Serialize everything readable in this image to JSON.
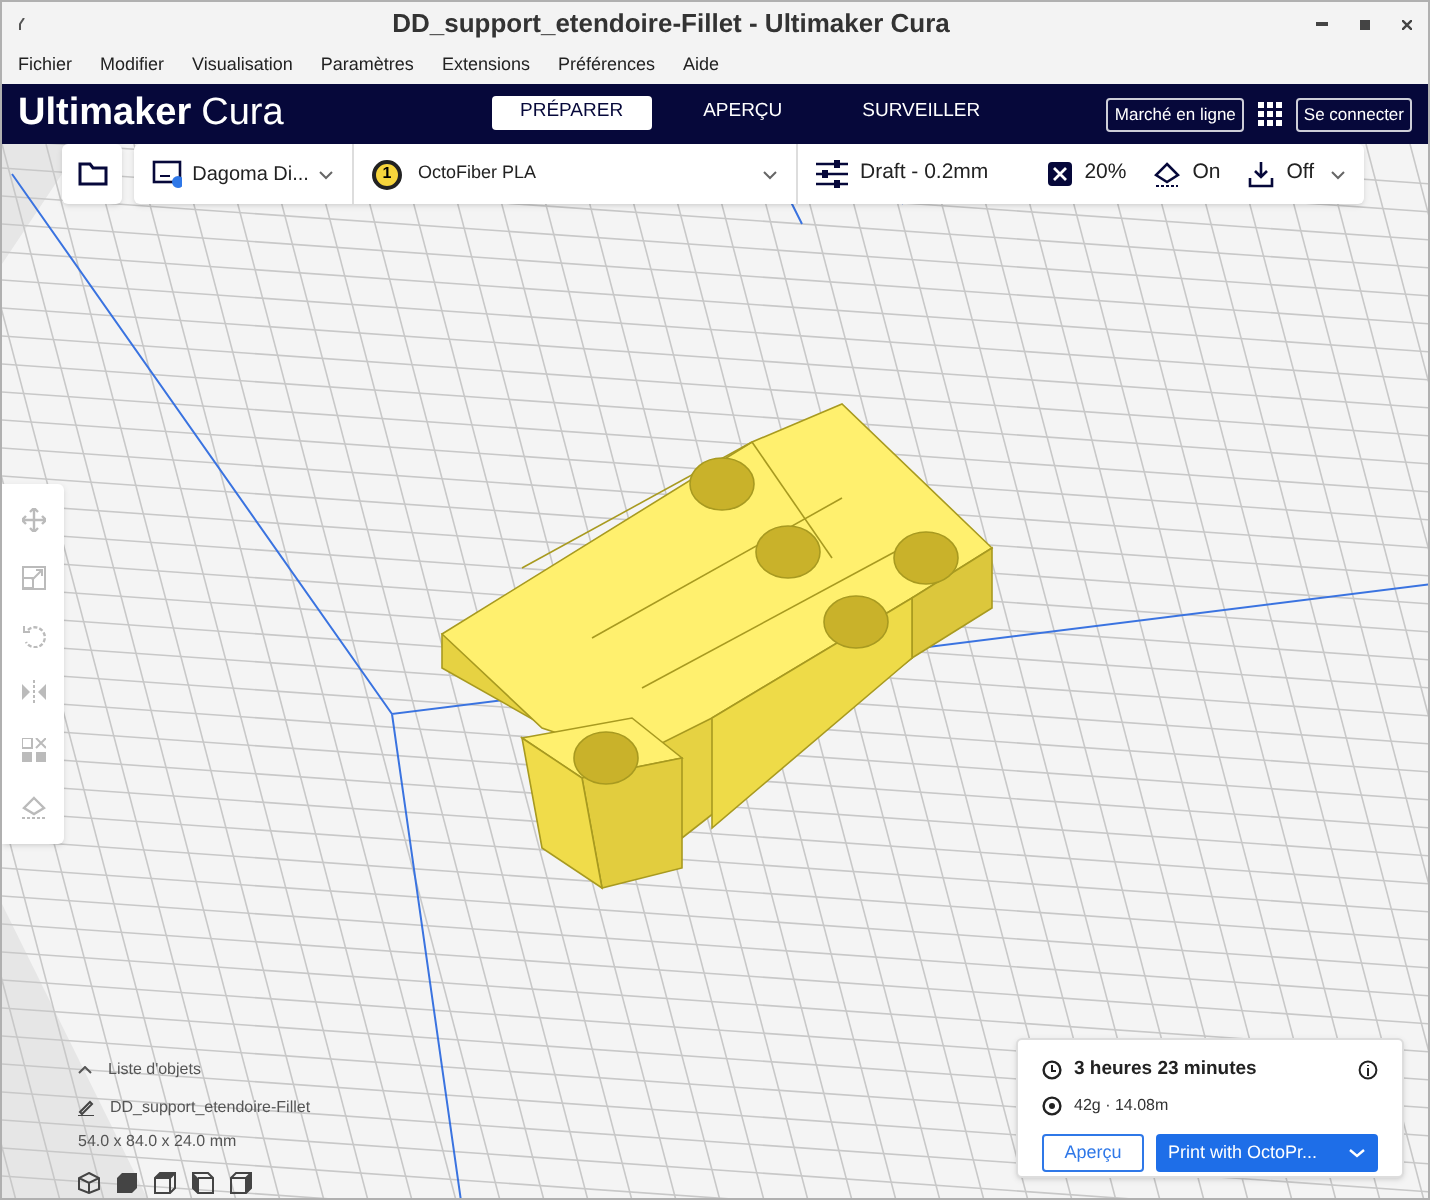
{
  "window": {
    "title": "DD_support_etendoire-Fillet - Ultimaker Cura"
  },
  "menu": [
    "Fichier",
    "Modifier",
    "Visualisation",
    "Paramètres",
    "Extensions",
    "Préférences",
    "Aide"
  ],
  "header": {
    "brand": "Ultimaker",
    "product": "Cura",
    "tabs": [
      {
        "label": "PRÉPARER",
        "selected": true
      },
      {
        "label": "APERÇU",
        "selected": false
      },
      {
        "label": "SURVEILLER",
        "selected": false
      }
    ],
    "marketplace": "Marché en ligne",
    "sign_in": "Se connecter"
  },
  "toolbar": {
    "printer": "Dagoma Di...",
    "extruder": "1",
    "material": "OctoFiber PLA",
    "profile": "Draft - 0.2mm",
    "infill": "20%",
    "support": "On",
    "adhesion": "Off"
  },
  "object_list": {
    "toggle": "Liste d'objets",
    "object_name": "DD_support_etendoire-Fillet",
    "dimensions": "54.0 x 84.0 x 24.0 mm"
  },
  "print_panel": {
    "time": "3 heures 23 minutes",
    "material_usage": "42g · 14.08m",
    "preview_button": "Aperçu",
    "print_button": "Print with OctoPr..."
  }
}
